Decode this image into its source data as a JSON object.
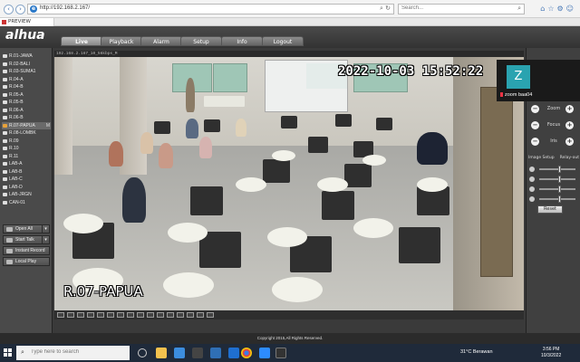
{
  "browser": {
    "url": "http://192.168.2.167/",
    "search_placeholder": "Search...",
    "tab_title": "PREVIEW"
  },
  "app": {
    "brand": "alhua",
    "menu": [
      "Live",
      "Playback",
      "Alarm",
      "Setup",
      "Info",
      "Logout"
    ],
    "active_menu": "Live"
  },
  "channels": [
    "R.01-JAWA",
    "R.02-BALI",
    "R.03-SUMA1",
    "R.04-A",
    "R.04-B",
    "R.05-A",
    "R.05-B",
    "R.06-A",
    "R.06-B",
    "R.07-PAPUA",
    "R.08-LOMBK",
    "R.09",
    "R.10",
    "R.11",
    "LAB-A",
    "LAB-B",
    "LAB-C",
    "LAB-D",
    "LAB-JRGN",
    "CAN-01"
  ],
  "selected_channel_mark": "M",
  "left_buttons": {
    "open_all": "Open All",
    "start_talk": "Start Talk",
    "instant_record": "Instant Record",
    "local_play": "Local Play"
  },
  "video": {
    "header": "192.168.2.167_10_56kbps_M",
    "timestamp": "2022-10-03 15:52:22",
    "camera_label": "R.07-PAPUA"
  },
  "zoom_overlay": {
    "avatar_letter": "Z",
    "name": "zoom baa04"
  },
  "ptz": {
    "zoom": "Zoom",
    "focus": "Focus",
    "iris": "Iris",
    "minus": "−",
    "plus": "+"
  },
  "image_setup": {
    "title": "Image Setup",
    "relay": "Relay-out",
    "reset": "Reset",
    "slider_levels": [
      0.55,
      0.55,
      0.55,
      0.55
    ]
  },
  "footer": "Copyright 2015,All Rights Reserved.",
  "taskbar": {
    "search_placeholder": "Type here to search",
    "weather": "31°C  Berawan",
    "time": "3:56 PM",
    "date": "10/3/2022"
  }
}
